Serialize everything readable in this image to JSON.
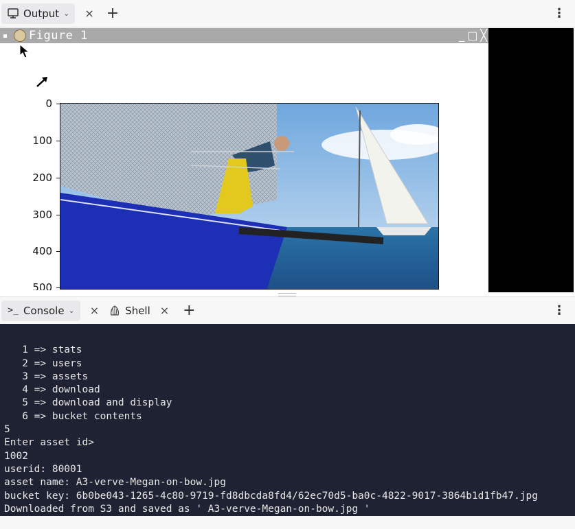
{
  "top_tabs": {
    "output_label": "Output",
    "close": "×",
    "add": "+",
    "menu": "⋮"
  },
  "figure": {
    "title": "Figure 1",
    "controls": [
      "_",
      "□",
      "╳"
    ],
    "y_ticks": [
      "0",
      "100",
      "200",
      "300",
      "400",
      "500"
    ]
  },
  "bottom_tabs": {
    "console_label": "Console",
    "shell_label": "Shell",
    "close": "×",
    "add": "+",
    "menu": "⋮"
  },
  "console": {
    "lines": [
      "   1 => stats",
      "   2 => users",
      "   3 => assets",
      "   4 => download",
      "   5 => download and display",
      "   6 => bucket contents",
      "5",
      "Enter asset id>",
      "1002",
      "userid: 80001",
      "asset name: A3-verve-Megan-on-bow.jpg",
      "bucket key: 6b0be043-1265-4c80-9719-fd8dbcda8fd4/62ec70d5-ba0c-4822-9017-3864b1d1fb47.jpg",
      "Downloaded from S3 and saved as ' A3-verve-Megan-on-bow.jpg '"
    ]
  },
  "colors": {
    "console_bg": "#1e2233",
    "figure_titlebar": "#a9a9a9"
  }
}
